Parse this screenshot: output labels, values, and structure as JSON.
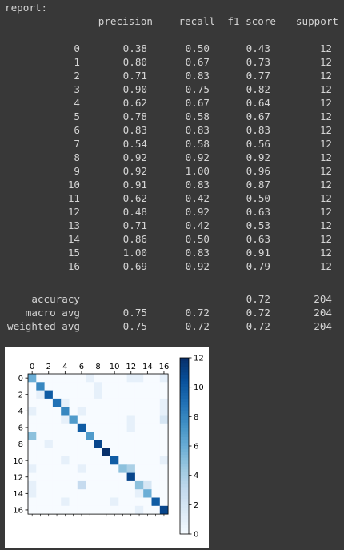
{
  "report": {
    "label": "report:",
    "headers": [
      "precision",
      "recall",
      "f1-score",
      "support"
    ],
    "rows": [
      {
        "label": "0",
        "precision": "0.38",
        "recall": "0.50",
        "f1": "0.43",
        "support": "12"
      },
      {
        "label": "1",
        "precision": "0.80",
        "recall": "0.67",
        "f1": "0.73",
        "support": "12"
      },
      {
        "label": "2",
        "precision": "0.71",
        "recall": "0.83",
        "f1": "0.77",
        "support": "12"
      },
      {
        "label": "3",
        "precision": "0.90",
        "recall": "0.75",
        "f1": "0.82",
        "support": "12"
      },
      {
        "label": "4",
        "precision": "0.62",
        "recall": "0.67",
        "f1": "0.64",
        "support": "12"
      },
      {
        "label": "5",
        "precision": "0.78",
        "recall": "0.58",
        "f1": "0.67",
        "support": "12"
      },
      {
        "label": "6",
        "precision": "0.83",
        "recall": "0.83",
        "f1": "0.83",
        "support": "12"
      },
      {
        "label": "7",
        "precision": "0.54",
        "recall": "0.58",
        "f1": "0.56",
        "support": "12"
      },
      {
        "label": "8",
        "precision": "0.92",
        "recall": "0.92",
        "f1": "0.92",
        "support": "12"
      },
      {
        "label": "9",
        "precision": "0.92",
        "recall": "1.00",
        "f1": "0.96",
        "support": "12"
      },
      {
        "label": "10",
        "precision": "0.91",
        "recall": "0.83",
        "f1": "0.87",
        "support": "12"
      },
      {
        "label": "11",
        "precision": "0.62",
        "recall": "0.42",
        "f1": "0.50",
        "support": "12"
      },
      {
        "label": "12",
        "precision": "0.48",
        "recall": "0.92",
        "f1": "0.63",
        "support": "12"
      },
      {
        "label": "13",
        "precision": "0.71",
        "recall": "0.42",
        "f1": "0.53",
        "support": "12"
      },
      {
        "label": "14",
        "precision": "0.86",
        "recall": "0.50",
        "f1": "0.63",
        "support": "12"
      },
      {
        "label": "15",
        "precision": "1.00",
        "recall": "0.83",
        "f1": "0.91",
        "support": "12"
      },
      {
        "label": "16",
        "precision": "0.69",
        "recall": "0.92",
        "f1": "0.79",
        "support": "12"
      }
    ],
    "summary": [
      {
        "label": "accuracy",
        "precision": "",
        "recall": "",
        "f1": "0.72",
        "support": "204"
      },
      {
        "label": "macro avg",
        "precision": "0.75",
        "recall": "0.72",
        "f1": "0.72",
        "support": "204"
      },
      {
        "label": "weighted avg",
        "precision": "0.75",
        "recall": "0.72",
        "f1": "0.72",
        "support": "204"
      }
    ]
  },
  "chart_data": {
    "type": "heatmap",
    "title": "",
    "xlabel": "",
    "ylabel": "",
    "x_ticks": [
      "0",
      "2",
      "4",
      "6",
      "8",
      "10",
      "12",
      "14",
      "16"
    ],
    "y_ticks": [
      "0",
      "2",
      "4",
      "6",
      "8",
      "10",
      "12",
      "14",
      "16"
    ],
    "colorbar_ticks": [
      "0",
      "2",
      "4",
      "6",
      "8",
      "10",
      "12"
    ],
    "range": [
      0,
      12
    ],
    "colormap": "Blues",
    "matrix": [
      [
        6,
        0,
        0,
        0,
        0,
        0,
        0,
        1,
        0,
        0,
        0,
        0,
        1,
        1,
        0,
        0,
        1
      ],
      [
        0,
        8,
        0,
        0,
        0,
        0,
        0,
        0,
        1,
        0,
        0,
        0,
        0,
        0,
        0,
        0,
        0
      ],
      [
        0,
        1,
        10,
        0,
        0,
        0,
        0,
        0,
        1,
        0,
        0,
        0,
        0,
        0,
        0,
        0,
        0
      ],
      [
        0,
        0,
        0,
        9,
        1,
        0,
        0,
        0,
        0,
        0,
        0,
        0,
        0,
        0,
        0,
        0,
        1
      ],
      [
        1,
        0,
        0,
        0,
        8,
        0,
        1,
        0,
        0,
        0,
        0,
        0,
        0,
        0,
        0,
        0,
        1
      ],
      [
        0,
        0,
        0,
        0,
        1,
        7,
        0,
        0,
        0,
        0,
        0,
        0,
        1,
        0,
        0,
        0,
        2
      ],
      [
        0,
        0,
        0,
        0,
        0,
        0,
        10,
        0,
        0,
        0,
        0,
        0,
        1,
        0,
        0,
        0,
        0
      ],
      [
        5,
        0,
        0,
        0,
        0,
        0,
        0,
        7,
        0,
        0,
        0,
        0,
        0,
        0,
        0,
        0,
        0
      ],
      [
        0,
        0,
        1,
        0,
        0,
        0,
        0,
        0,
        11,
        0,
        0,
        0,
        0,
        0,
        0,
        0,
        0
      ],
      [
        0,
        0,
        0,
        0,
        0,
        0,
        0,
        0,
        0,
        12,
        0,
        0,
        0,
        0,
        0,
        0,
        0
      ],
      [
        0,
        0,
        0,
        0,
        1,
        0,
        0,
        0,
        0,
        0,
        10,
        0,
        0,
        0,
        0,
        0,
        1
      ],
      [
        1,
        0,
        0,
        0,
        0,
        0,
        1,
        0,
        0,
        0,
        0,
        5,
        4,
        0,
        0,
        0,
        0
      ],
      [
        0,
        0,
        0,
        0,
        0,
        0,
        0,
        0,
        0,
        0,
        0,
        0,
        11,
        0,
        0,
        0,
        0
      ],
      [
        1,
        0,
        0,
        0,
        0,
        0,
        3,
        0,
        0,
        0,
        0,
        0,
        0,
        5,
        2,
        0,
        0
      ],
      [
        1,
        0,
        0,
        0,
        0,
        0,
        0,
        0,
        0,
        0,
        0,
        0,
        0,
        1,
        6,
        0,
        0
      ],
      [
        0,
        0,
        0,
        0,
        1,
        0,
        0,
        0,
        0,
        0,
        1,
        0,
        0,
        0,
        0,
        10,
        0
      ],
      [
        0,
        0,
        0,
        0,
        0,
        0,
        0,
        0,
        0,
        0,
        0,
        0,
        0,
        1,
        0,
        0,
        11
      ]
    ]
  }
}
